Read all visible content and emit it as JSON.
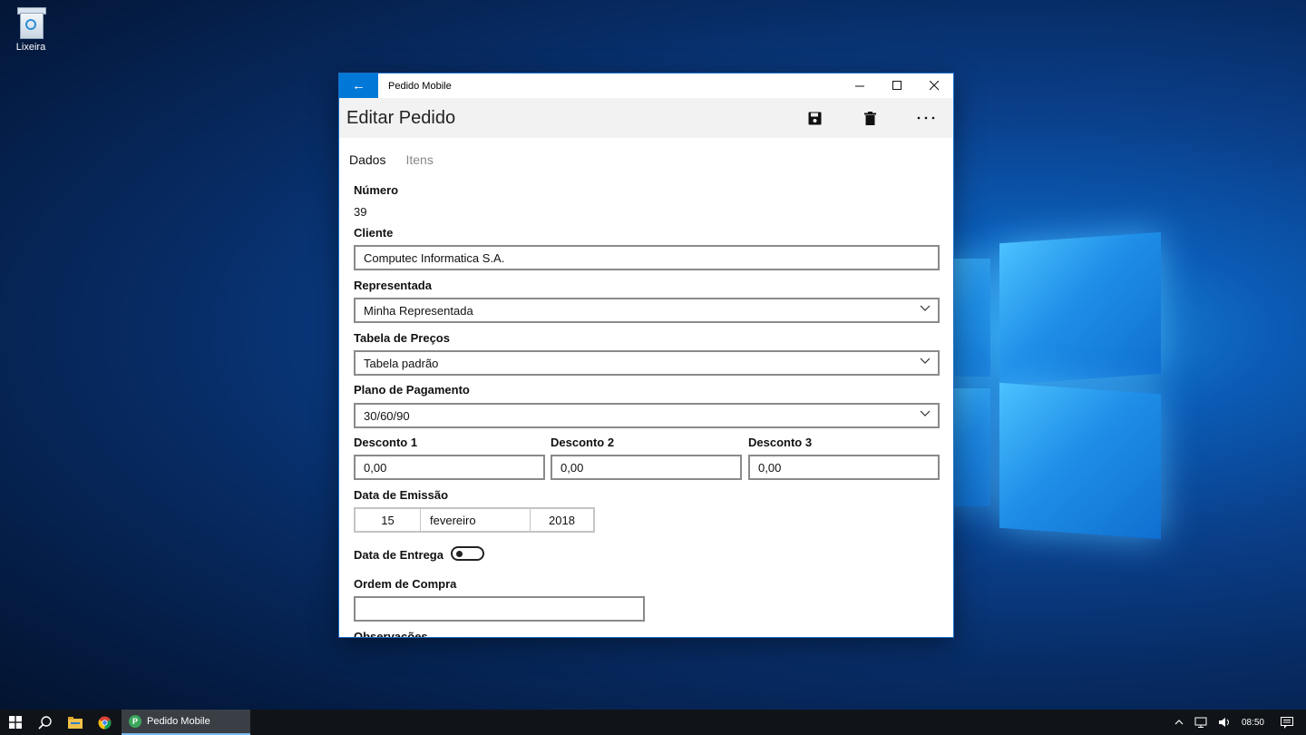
{
  "desktop": {
    "recycle_bin_label": "Lixeira"
  },
  "window": {
    "app_title": "Pedido Mobile",
    "page_title": "Editar Pedido",
    "tabs": [
      {
        "label": "Dados",
        "active": true
      },
      {
        "label": "Itens",
        "active": false
      }
    ]
  },
  "form": {
    "numero_label": "Número",
    "numero_value": "39",
    "cliente_label": "Cliente",
    "cliente_value": "Computec Informatica S.A.",
    "representada_label": "Representada",
    "representada_value": "Minha Representada",
    "tabela_label": "Tabela de Preços",
    "tabela_value": "Tabela padrão",
    "plano_label": "Plano de Pagamento",
    "plano_value": "30/60/90",
    "desconto1_label": "Desconto 1",
    "desconto1_value": "0,00",
    "desconto2_label": "Desconto 2",
    "desconto2_value": "0,00",
    "desconto3_label": "Desconto 3",
    "desconto3_value": "0,00",
    "emissao_label": "Data de Emissão",
    "emissao_day": "15",
    "emissao_month": "fevereiro",
    "emissao_year": "2018",
    "entrega_label": "Data de Entrega",
    "entrega_enabled": false,
    "ordem_label": "Ordem de Compra",
    "ordem_value": "",
    "observacoes_label": "Observações"
  },
  "taskbar": {
    "app_label": "Pedido Mobile",
    "clock": "08:50"
  },
  "colors": {
    "accent": "#0078d7",
    "taskbar": "#101418"
  }
}
